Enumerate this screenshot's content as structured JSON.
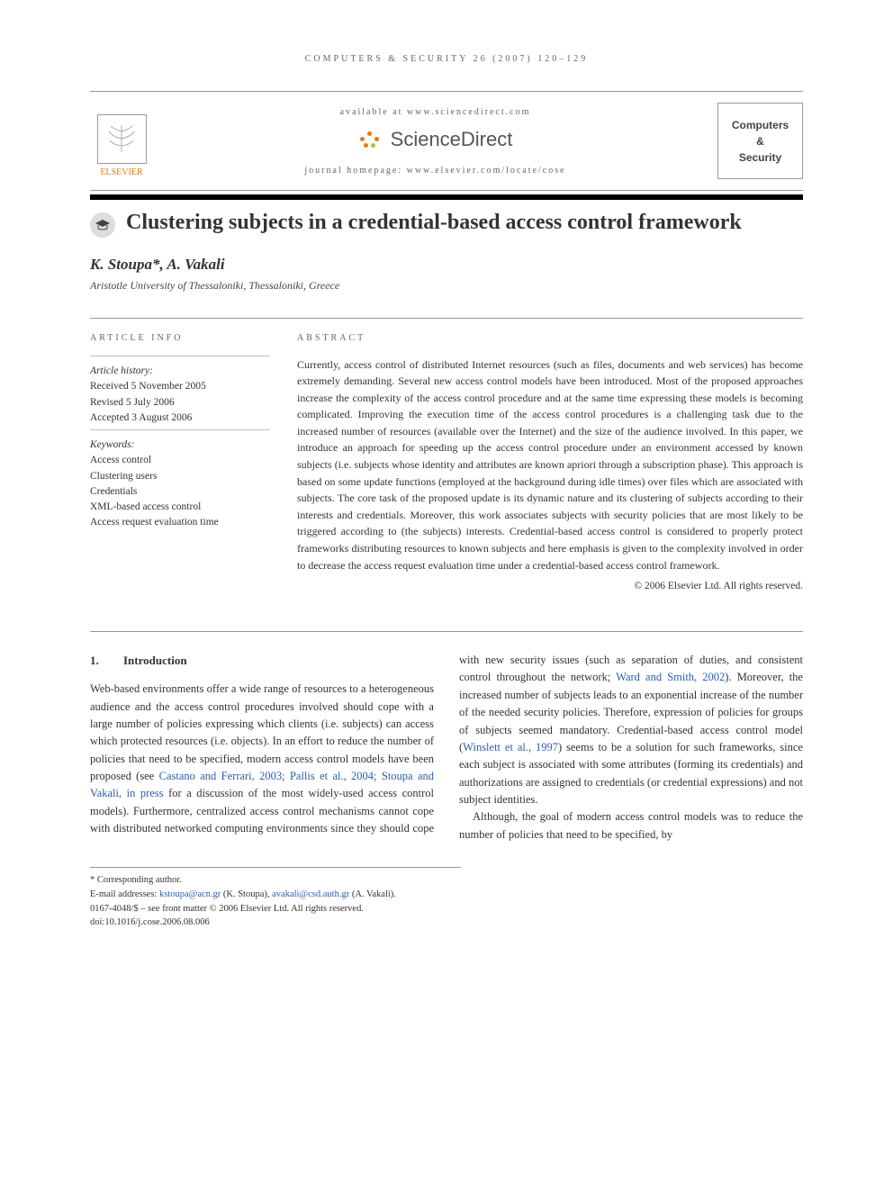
{
  "running_head": "COMPUTERS & SECURITY 26 (2007) 120–129",
  "header": {
    "available_at": "available at www.sciencedirect.com",
    "sd_brand": "ScienceDirect",
    "homepage": "journal homepage: www.elsevier.com/locate/cose",
    "publisher_name": "ELSEVIER",
    "journal_cover_line1": "Computers",
    "journal_cover_line2": "&",
    "journal_cover_line3": "Security"
  },
  "article": {
    "title": "Clustering subjects in a credential-based access control framework",
    "authors": "K. Stoupa*, A. Vakali",
    "affiliation": "Aristotle University of Thessaloniki, Thessaloniki, Greece"
  },
  "article_info": {
    "head": "ARTICLE INFO",
    "history_label": "Article history:",
    "received": "Received 5 November 2005",
    "revised": "Revised 5 July 2006",
    "accepted": "Accepted 3 August 2006",
    "keywords_label": "Keywords:",
    "keywords": [
      "Access control",
      "Clustering users",
      "Credentials",
      "XML-based access control",
      "Access request evaluation time"
    ]
  },
  "abstract": {
    "head": "ABSTRACT",
    "text": "Currently, access control of distributed Internet resources (such as files, documents and web services) has become extremely demanding. Several new access control models have been introduced. Most of the proposed approaches increase the complexity of the access control procedure and at the same time expressing these models is becoming complicated. Improving the execution time of the access control procedures is a challenging task due to the increased number of resources (available over the Internet) and the size of the audience involved. In this paper, we introduce an approach for speeding up the access control procedure under an environment accessed by known subjects (i.e. subjects whose identity and attributes are known apriori through a subscription phase). This approach is based on some update functions (employed at the background during idle times) over files which are associated with subjects. The core task of the proposed update is its dynamic nature and its clustering of subjects according to their interests and credentials. Moreover, this work associates subjects with security policies that are most likely to be triggered according to (the subjects) interests. Credential-based access control is considered to properly protect frameworks distributing resources to known subjects and here emphasis is given to the complexity involved in order to decrease the access request evaluation time under a credential-based access control framework.",
    "copyright": "© 2006 Elsevier Ltd. All rights reserved."
  },
  "body": {
    "section_number": "1.",
    "section_title": "Introduction",
    "p1_a": "Web-based environments offer a wide range of resources to a heterogeneous audience and the access control procedures involved should cope with a large number of policies expressing which clients (i.e. subjects) can access which protected resources (i.e. objects). In an effort to reduce the number of policies that need to be specified, modern access control models have been proposed (see ",
    "p1_ref1": "Castano and Ferrari, 2003; Pallis et al., 2004; Stoupa and Vakali, in press",
    "p1_b": " for a discussion of the most widely-used access control models). Furthermore, centralized access control mechanisms cannot cope with distributed networked computing environments since they should cope with",
    "p2_a": "new security issues (such as separation of duties, and consistent control throughout the network; ",
    "p2_ref1": "Ward and Smith, 2002",
    "p2_b": "). Moreover, the increased number of subjects leads to an exponential increase of the number of the needed security policies. Therefore, expression of policies for groups of subjects seemed mandatory. Credential-based access control model (",
    "p2_ref2": "Winslett et al., 1997",
    "p2_c": ") seems to be a solution for such frameworks, since each subject is associated with some attributes (forming its credentials) and authorizations are assigned to credentials (or credential expressions) and not subject identities.",
    "p3": "Although, the goal of modern access control models was to reduce the number of policies that need to be specified, by"
  },
  "footnotes": {
    "corresponding": "* Corresponding author.",
    "email_label": "E-mail addresses: ",
    "email1": "kstoupa@acn.gr",
    "email1_who": " (K. Stoupa), ",
    "email2": "avakali@csd.auth.gr",
    "email2_who": " (A. Vakali).",
    "front_matter": "0167-4048/$ – see front matter © 2006 Elsevier Ltd. All rights reserved.",
    "doi": "doi:10.1016/j.cose.2006.08.006"
  }
}
